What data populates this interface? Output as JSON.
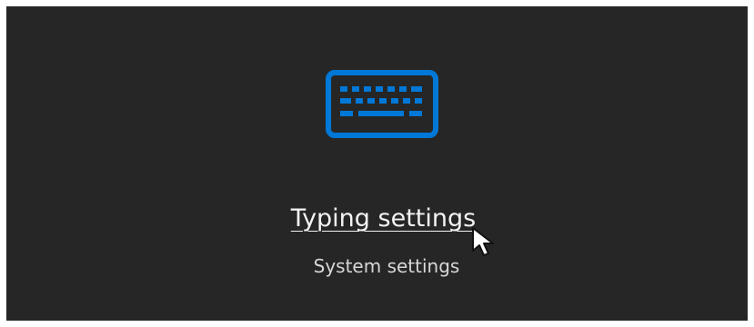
{
  "setting": {
    "icon": "keyboard-icon",
    "title": "Typing settings",
    "subtitle": "System settings"
  },
  "theme": {
    "background": "#262626",
    "accent": "#0078D7",
    "text": "#F3F3F3",
    "secondary_text": "#D7D7D7"
  },
  "cursor": {
    "icon": "mouse-pointer-icon"
  }
}
